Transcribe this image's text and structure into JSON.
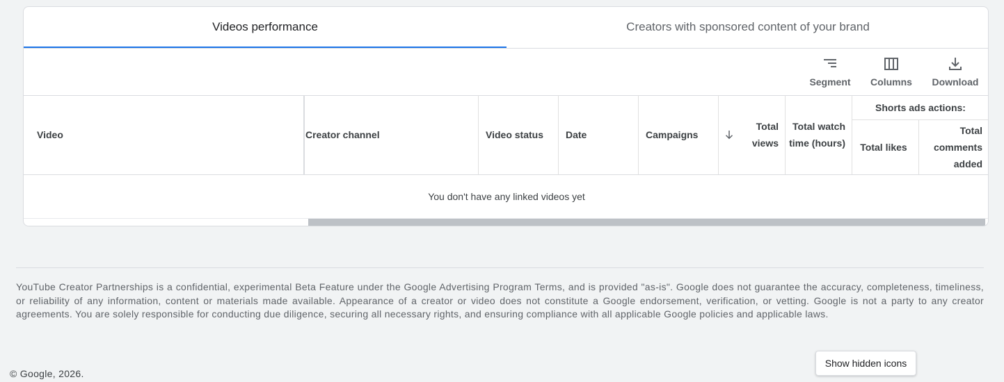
{
  "tabs": [
    {
      "label": "Videos performance",
      "active": true
    },
    {
      "label": "Creators with sponsored content of your brand",
      "active": false
    }
  ],
  "toolbar": {
    "segment": {
      "label": "Segment",
      "icon": "segment-icon"
    },
    "columns": {
      "label": "Columns",
      "icon": "columns-icon"
    },
    "download": {
      "label": "Download",
      "icon": "download-icon"
    }
  },
  "table": {
    "columns": {
      "video": "Video",
      "creator_channel": "Creator channel",
      "video_status": "Video status",
      "date": "Date",
      "campaigns": "Campaigns",
      "total_views": "Total views",
      "total_watch_time": "Total watch time (hours)"
    },
    "sort_icon": "arrow-down-icon",
    "group_header": "Shorts ads actions:",
    "group_columns": {
      "total_likes": "Total likes",
      "total_comments_added": "Total comments added"
    },
    "empty_message": "You don't have any linked videos yet"
  },
  "disclaimer": "YouTube Creator Partnerships is a confidential, experimental Beta Feature under the Google Advertising Program Terms, and is provided \"as-is\". Google does not guarantee the accuracy, completeness, timeliness, or reliability of any information, content or materials made available. Appearance of a creator or video does not constitute a Google endorsement, verification, or vetting. Google is not a party to any creator agreements. You are solely responsible for conducting due diligence, securing all necessary rights, and ensuring compliance with all applicable Google policies and applicable laws.",
  "copyright": "© Google, 2026.",
  "tooltip": "Show hidden icons",
  "colors": {
    "accent": "#1a73e8",
    "background": "#f1f3f4"
  }
}
